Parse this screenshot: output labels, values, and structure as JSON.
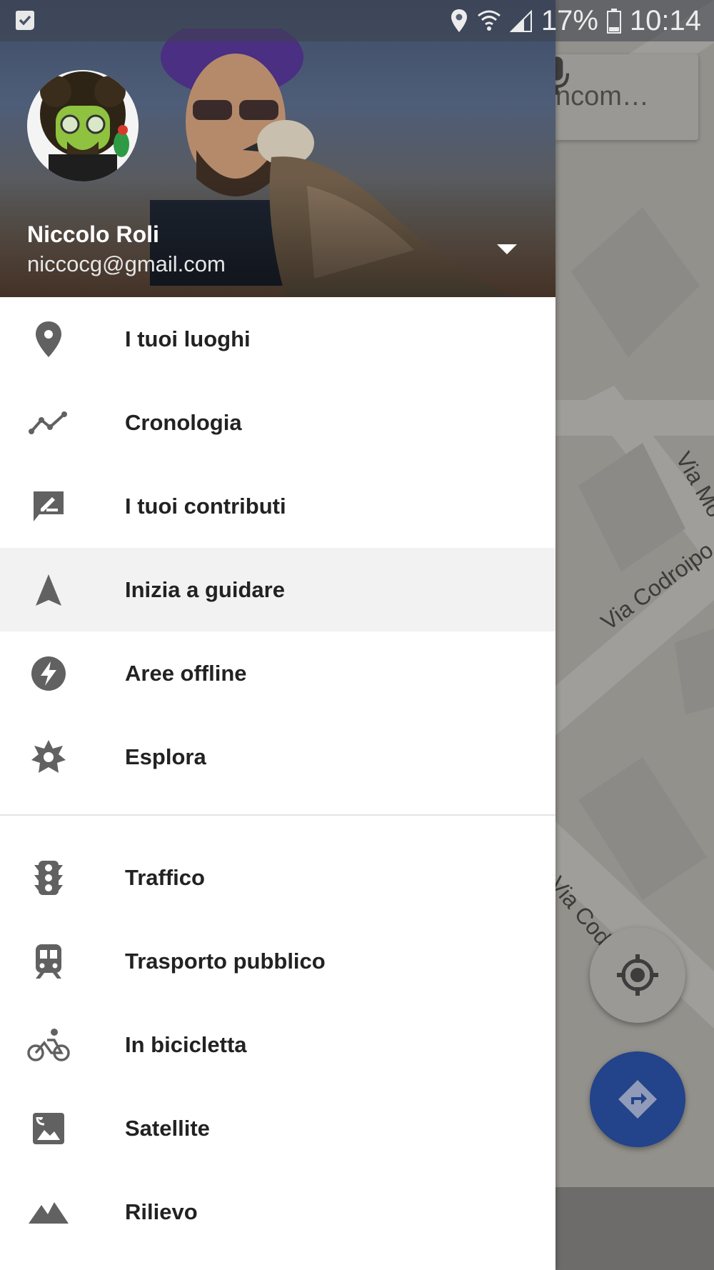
{
  "status_bar": {
    "battery": "17%",
    "time": "10:14"
  },
  "map": {
    "search_text": "ncom…",
    "streets": [
      "Via Mo",
      "Via Codroipo",
      "Via Codro"
    ]
  },
  "account": {
    "name": "Niccolo Roli",
    "email": "niccocg@gmail.com"
  },
  "menu": {
    "group1": [
      {
        "label": "I tuoi luoghi",
        "icon": "place-pin-icon"
      },
      {
        "label": "Cronologia",
        "icon": "timeline-icon"
      },
      {
        "label": "I tuoi contributi",
        "icon": "rate-review-icon"
      },
      {
        "label": "Inizia a guidare",
        "icon": "navigation-icon",
        "active": true
      },
      {
        "label": "Aree offline",
        "icon": "offline-bolt-icon"
      },
      {
        "label": "Esplora",
        "icon": "explore-icon"
      }
    ],
    "group2": [
      {
        "label": "Traffico",
        "icon": "traffic-icon"
      },
      {
        "label": "Trasporto pubblico",
        "icon": "transit-icon"
      },
      {
        "label": "In bicicletta",
        "icon": "bicycle-icon"
      },
      {
        "label": "Satellite",
        "icon": "satellite-icon"
      },
      {
        "label": "Rilievo",
        "icon": "terrain-icon"
      }
    ]
  },
  "colors": {
    "active_row": "#f2f2f2",
    "icon_gray": "#616161",
    "directions_fab": "#23438a"
  }
}
